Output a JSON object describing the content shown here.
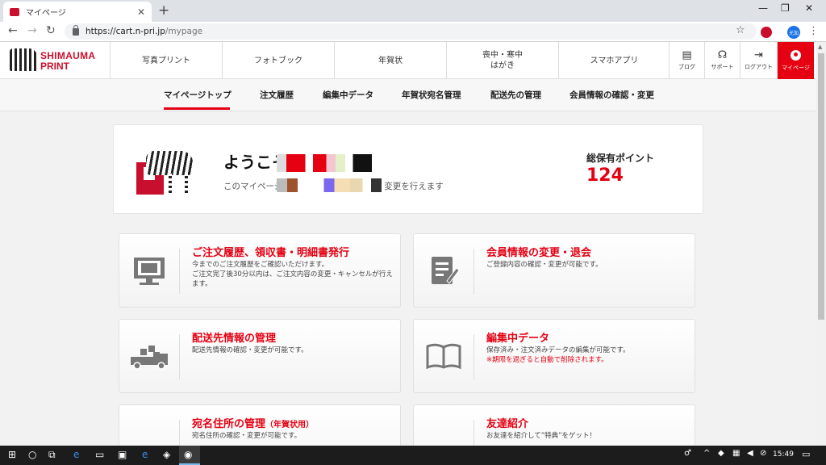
{
  "browser": {
    "tab_title": "マイページ",
    "new_tab": "+",
    "url_host": "https://cart.n-pri.jp",
    "url_path": "/mypage",
    "profile_label": "光加"
  },
  "header": {
    "logo_line1": "SHIMAUMA",
    "logo_line2": "PRINT",
    "nav": [
      "写真プリント",
      "フォトブック",
      "年賀状",
      "喪中・寒中\nはがき",
      "スマホアプリ"
    ],
    "util": [
      {
        "label": "ブログ",
        "icon": "blog-icon"
      },
      {
        "label": "サポート",
        "icon": "headset-icon"
      },
      {
        "label": "ログアウト",
        "icon": "logout-icon"
      },
      {
        "label": "マイページ",
        "icon": "user-icon"
      }
    ]
  },
  "subnav": {
    "items": [
      "マイページトップ",
      "注文履歴",
      "編集中データ",
      "年賀状宛名管理",
      "配送先の管理",
      "会員情報の確認・変更"
    ]
  },
  "welcome": {
    "title": "ようこそ",
    "description": "このマイページでは、配送先などの確認・変更を行えます",
    "points_label": "総保有ポイント",
    "points_value": "124"
  },
  "cards": [
    {
      "title": "ご注文履歴、領収書・明細書発行",
      "title_sub": "",
      "desc": "今までのご注文履歴をご確認いただけます。\nご注文完了後30分以内は、ご注文内容の変更・キャンセルが行えます。",
      "warn": "",
      "icon": "photo-monitor-icon"
    },
    {
      "title": "会員情報の変更・退会",
      "title_sub": "",
      "desc": "ご登録内容の確認・変更が可能です。",
      "warn": "",
      "icon": "edit-form-icon"
    },
    {
      "title": "配送先情報の管理",
      "title_sub": "",
      "desc": "配送先情報の確認・変更が可能です。",
      "warn": "",
      "icon": "truck-icon"
    },
    {
      "title": "編集中データ",
      "title_sub": "",
      "desc": "保存済み・注文済みデータの編集が可能です。",
      "warn": "※期限を過ぎると自動で削除されます。",
      "icon": "book-icon"
    },
    {
      "title": "宛名住所の管理",
      "title_sub": "（年賀状用）",
      "desc": "宛名住所の確認・変更が可能です。",
      "warn": "",
      "icon": "postal-icon"
    },
    {
      "title": "友達紹介",
      "title_sub": "",
      "desc": "お友達を紹介して”特典”をゲット！",
      "warn": "",
      "icon": "friends-icon"
    }
  ],
  "taskbar": {
    "clock": "15:49"
  },
  "colors": {
    "brand_red": "#e50012",
    "taskbar": "#1c1c1c"
  }
}
